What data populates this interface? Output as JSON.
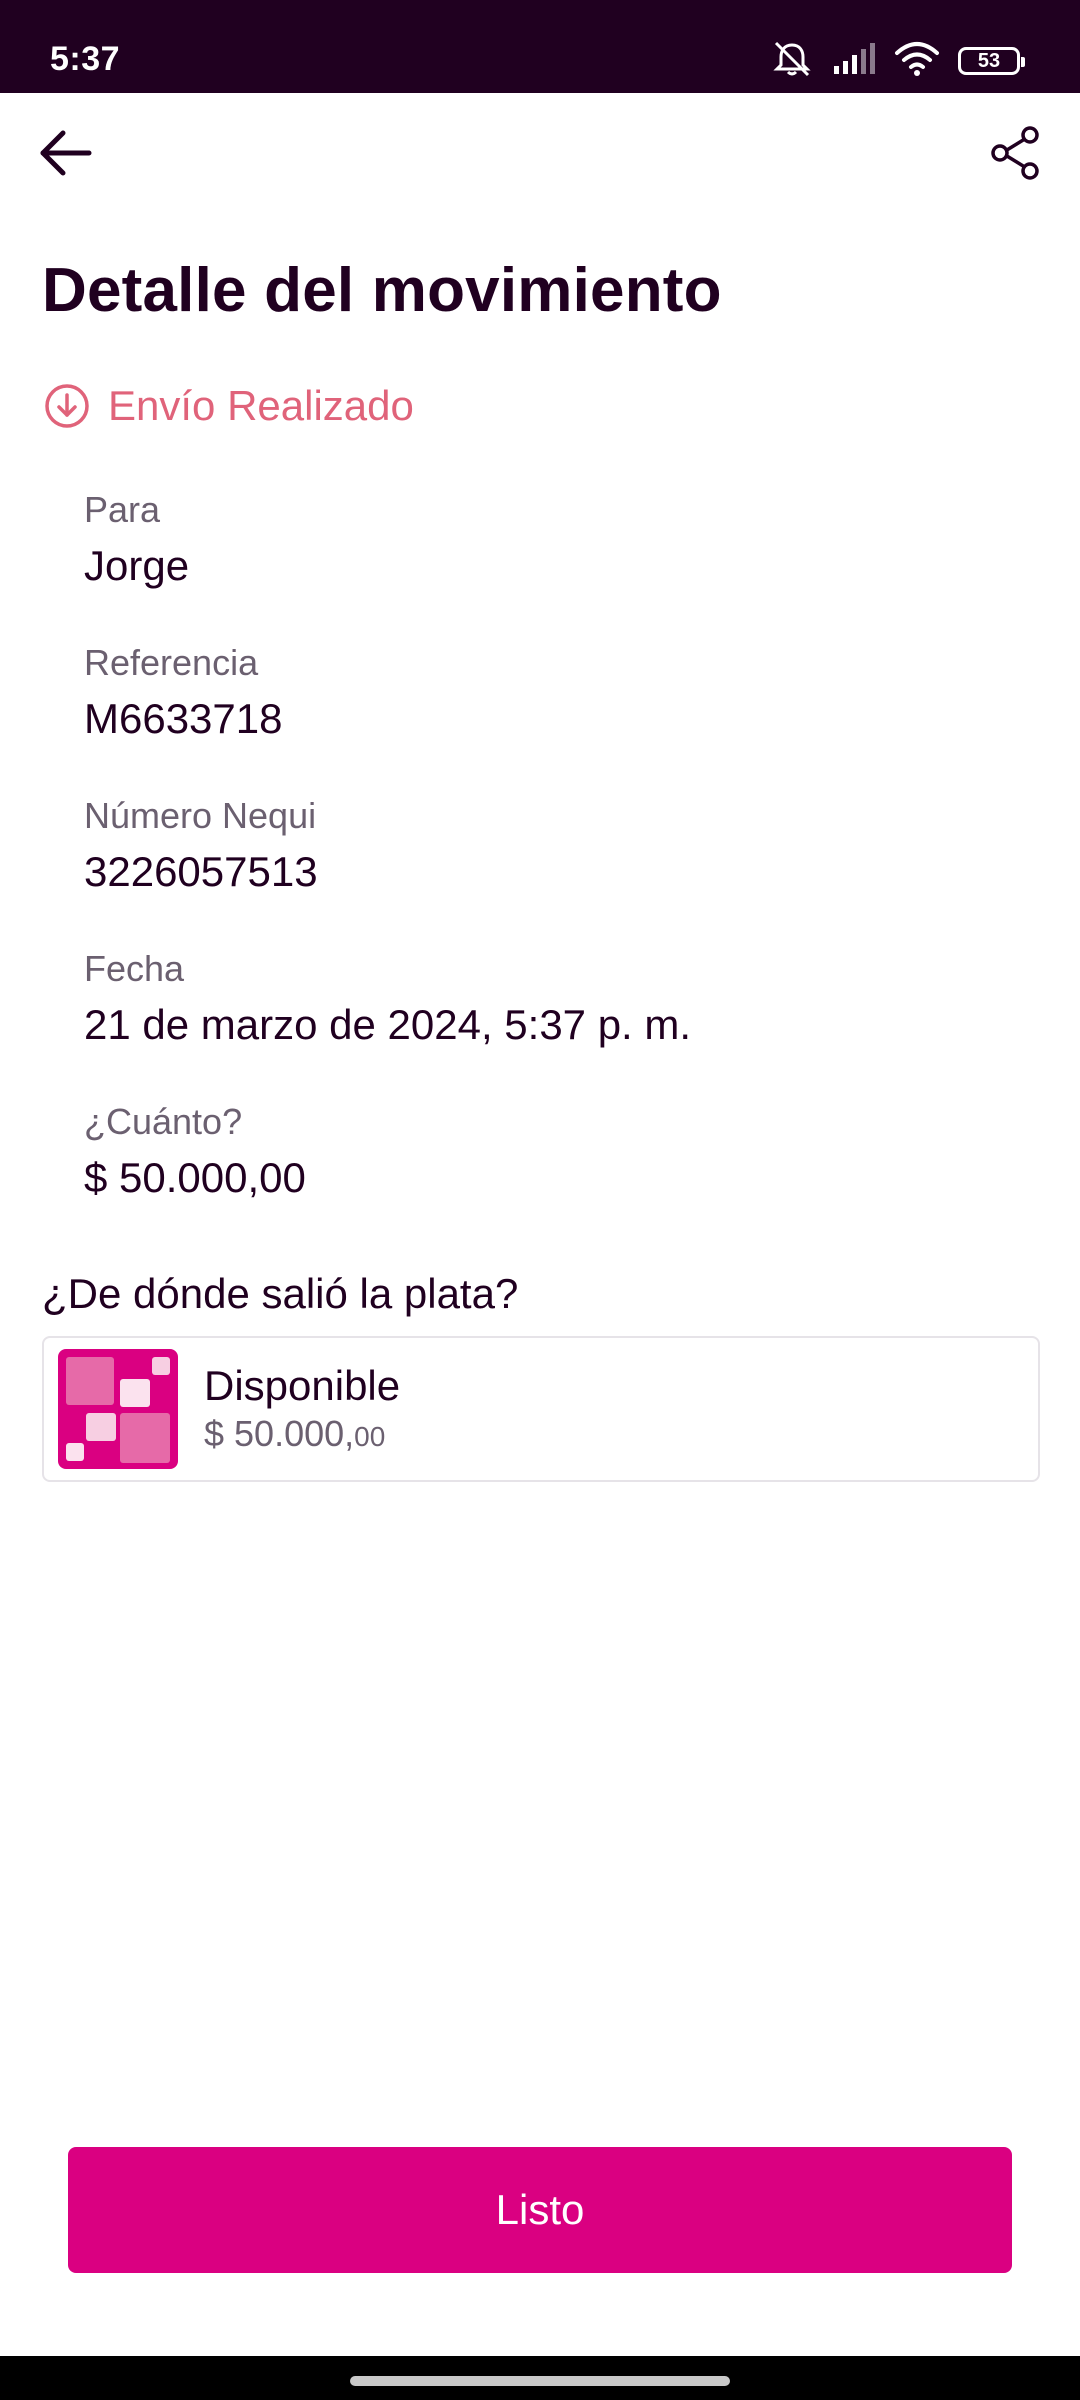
{
  "status_bar": {
    "time": "5:37",
    "battery": "53",
    "icons": [
      "mute-icon",
      "signal-icon",
      "wifi-icon",
      "battery-icon"
    ]
  },
  "header": {
    "back_icon": "back-arrow-icon",
    "share_icon": "share-icon",
    "title": "Detalle del movimiento"
  },
  "transaction": {
    "status_icon": "arrow-down-circle-icon",
    "status": "Envío Realizado",
    "status_color": "#e0637a",
    "fields": [
      {
        "label": "Para",
        "value": "Jorge"
      },
      {
        "label": "Referencia",
        "value": "M6633718"
      },
      {
        "label": "Número Nequi",
        "value": "3226057513"
      },
      {
        "label": "Fecha",
        "value": "21 de marzo de 2024, 5:37 p. m."
      },
      {
        "label": "¿Cuánto?",
        "value": "$ 50.000,00"
      }
    ]
  },
  "source": {
    "title": "¿De dónde salió la plata?",
    "name": "Disponible",
    "amount_main": "$ 50.000,",
    "amount_cents": "00",
    "icon_color": "#da0081"
  },
  "footer": {
    "button_label": "Listo",
    "button_color": "#da0081"
  }
}
